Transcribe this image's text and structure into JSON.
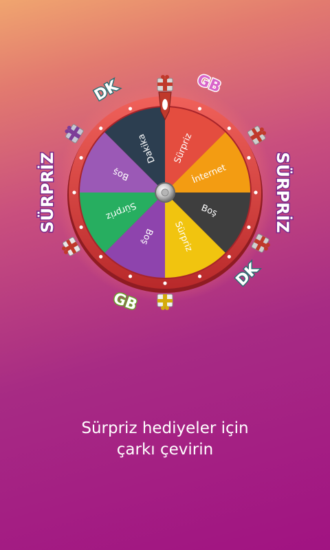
{
  "wheel": {
    "segments": [
      {
        "label": "Sürpriz",
        "color": "#e44d3f"
      },
      {
        "label": "İnternet",
        "color": "#f39c12"
      },
      {
        "label": "Boş",
        "color": "#3e3e3e"
      },
      {
        "label": "Sürpriz",
        "color": "#f1c40f"
      },
      {
        "label": "Boş",
        "color": "#8e44ad"
      },
      {
        "label": "Sürpriz",
        "color": "#27ae60"
      },
      {
        "label": "Boş",
        "color": "#9b59b6"
      },
      {
        "label": "Dakika",
        "color": "#2c3e50"
      }
    ],
    "outer_labels": [
      {
        "text": "GB",
        "fill": "#d864c9",
        "stroke": "#ffffff"
      },
      {
        "text": "SÜRPRİZ",
        "fill": "#ffffff",
        "stroke": "#7b2a8c"
      },
      {
        "text": "DK",
        "fill": "#ffffff",
        "stroke": "#2c6e72"
      },
      {
        "text": "GB",
        "fill": "#ffffff",
        "stroke": "#6b9e2a"
      },
      {
        "text": "SÜRPRİZ",
        "fill": "#ffffff",
        "stroke": "#7b2a8c"
      },
      {
        "text": "DK",
        "fill": "#ffffff",
        "stroke": "#2c6e72"
      }
    ],
    "gift_icons": [
      "gift-box-icon",
      "gift-box-icon",
      "gift-box-icon",
      "gift-box-icon",
      "gift-box-icon",
      "gift-box-icon"
    ],
    "rim_color": "#d6413a",
    "pointer_icon": "wheel-pointer-icon",
    "hub_icon": "wheel-hub-icon"
  },
  "caption": {
    "line1": "Sürpriz hediyeler için",
    "line2": "çarkı çevirin"
  }
}
